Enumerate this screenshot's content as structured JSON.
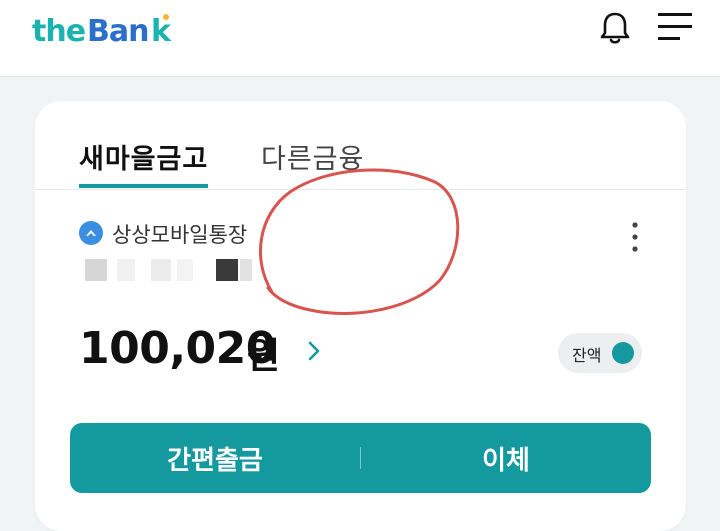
{
  "header": {
    "logo_text": "theBank",
    "notification_icon": "bell-icon",
    "menu_icon": "hamburger-menu-icon"
  },
  "tabs": [
    {
      "label": "새마을금고",
      "active": true
    },
    {
      "label": "다른금융",
      "active": false
    }
  ],
  "account": {
    "icon": "account-type-icon",
    "name": "상상모바일통장",
    "more_icon": "more-vertical-icon",
    "balance_amount": "100,020",
    "balance_unit": "원",
    "balance_chevron": "chevron-right-icon",
    "balance_toggle_label": "잔액",
    "balance_toggle_on": true
  },
  "actions": {
    "quick_withdraw_label": "간편출금",
    "transfer_label": "이체"
  },
  "colors": {
    "brand": "#14999e",
    "logo_teal": "#1bb3b0",
    "logo_blue": "#2a6fc9",
    "annotation": "#d9534f"
  }
}
